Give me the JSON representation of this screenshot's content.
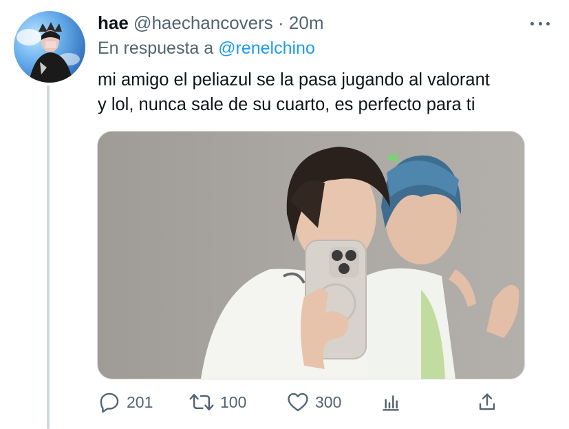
{
  "tweet": {
    "display_name": "hae",
    "handle": "@haechancovers",
    "separator": "·",
    "time": "20m",
    "reply_prefix": "En respuesta a",
    "reply_to": "@renelchino",
    "text_lines": [
      "mi amigo el peliazul se la pasa jugando al valorant",
      "y lol, nunca sale de su cuarto, es perfecto para ti"
    ]
  },
  "actions": {
    "replies": "201",
    "retweets": "100",
    "likes": "300"
  },
  "icons": [
    "more-icon",
    "reply-icon",
    "retweet-icon",
    "like-icon",
    "analytics-icon",
    "share-icon"
  ],
  "colors": {
    "text": "#0f1419",
    "muted": "#536471",
    "link": "#1d9bf0",
    "thread_line": "#cfd9de"
  }
}
